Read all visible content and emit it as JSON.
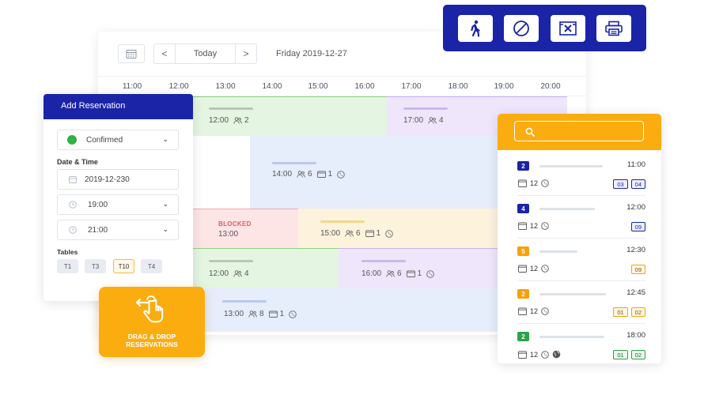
{
  "toolbar": {
    "today_label": "Today",
    "prev": "<",
    "next": ">",
    "date": "Friday 2019-12-27"
  },
  "hours": [
    "11:00",
    "12:00",
    "13:00",
    "14:00",
    "15:00",
    "16:00",
    "17:00",
    "18:00",
    "19:00",
    "20:00"
  ],
  "reservations": [
    {
      "time": "12:00",
      "guests": "2",
      "color": "green"
    },
    {
      "time": "17:00",
      "guests": "4",
      "color": "purple"
    },
    {
      "time": "14:00",
      "guests": "6",
      "tables": "1",
      "color": "blue"
    },
    {
      "status": "BLOCKED",
      "time": "13:00",
      "color": "red"
    },
    {
      "time": "15:00",
      "guests": "6",
      "tables": "1",
      "color": "yellow"
    },
    {
      "time": "12:00",
      "guests": "4",
      "color": "green"
    },
    {
      "time": "16:00",
      "guests": "6",
      "tables": "1",
      "color": "purple"
    },
    {
      "time": "13:00",
      "guests": "8",
      "tables": "1",
      "color": "blue"
    }
  ],
  "add_reservation": {
    "title": "Add Reservation",
    "status": "Confirmed",
    "status_color": "#2fb344",
    "date_time_label": "Date & Time",
    "date": "2019-12-230",
    "start_time": "19:00",
    "end_time": "21:00",
    "tables_label": "Tables",
    "tables": [
      "T1",
      "T3",
      "T10",
      "T4"
    ],
    "selected_table": "T10"
  },
  "drag_drop": {
    "line1": "DRAG & DROP",
    "line2": "RESERVATIONS"
  },
  "list": [
    {
      "count": "2",
      "time": "11:00",
      "guests": "12",
      "tags": [
        "03",
        "04"
      ],
      "color": "#1b24a6"
    },
    {
      "count": "4",
      "time": "12:00",
      "guests": "12",
      "tags": [
        "09"
      ],
      "color": "#1b24a6"
    },
    {
      "count": "5",
      "time": "12:30",
      "guests": "12",
      "tags": [
        "09"
      ],
      "color": "#f5a20a"
    },
    {
      "count": "2",
      "time": "12:45",
      "guests": "12",
      "tags": [
        "01",
        "02"
      ],
      "color": "#f5a20a"
    },
    {
      "count": "2",
      "time": "18:00",
      "guests": "12",
      "tags": [
        "01",
        "02"
      ],
      "color": "#2ca24a"
    }
  ],
  "colors": {
    "brand_blue": "#1b24a6",
    "accent_orange": "#fbac0f"
  }
}
